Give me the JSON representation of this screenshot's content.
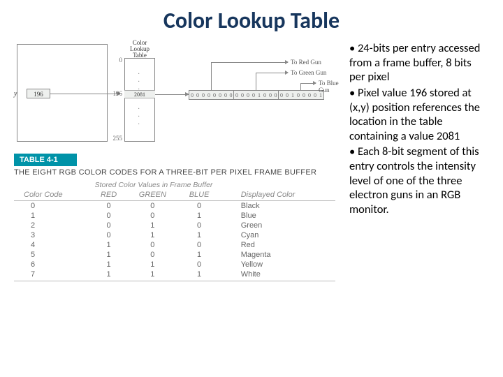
{
  "title": "Color Lookup Table",
  "bullets": {
    "b1": "• 24-bits per entry accessed from a frame buffer, 8 bits per pixel",
    "b2": "• Pixel value 196 stored at (x,y) position references the location in the table containing a value 2081",
    "b3": "• Each 8-bit segment of this entry controls the intensity level of one of the three electron guns  in an RGB monitor."
  },
  "diagram": {
    "y": "y",
    "pixel": "196",
    "clt_label": "Color\nLookup\nTable",
    "idx0": "0",
    "idx196": "196",
    "idx255": "255",
    "entry": "2081",
    "bits": [
      "0",
      "0",
      "0",
      "0",
      "0",
      "0",
      "0",
      "0",
      "0",
      "0",
      "0",
      "0",
      "1",
      "0",
      "0",
      "0",
      "0",
      "0",
      "1",
      "0",
      "0",
      "0",
      "0",
      "1"
    ],
    "red": "To Red Gun",
    "green": "To Green Gun",
    "blue": "To Blue Gun"
  },
  "table": {
    "bar": "TABLE 4-1",
    "caption": "THE EIGHT RGB COLOR CODES FOR A THREE-BIT PER PIXEL FRAME BUFFER",
    "subhead": "Stored Color Values in Frame Buffer",
    "headers": {
      "code": "Color Code",
      "red": "RED",
      "green": "GREEN",
      "blue": "BLUE",
      "disp": "Displayed Color"
    },
    "rows": [
      {
        "c": "0",
        "r": "0",
        "g": "0",
        "b": "0",
        "d": "Black"
      },
      {
        "c": "1",
        "r": "0",
        "g": "0",
        "b": "1",
        "d": "Blue"
      },
      {
        "c": "2",
        "r": "0",
        "g": "1",
        "b": "0",
        "d": "Green"
      },
      {
        "c": "3",
        "r": "0",
        "g": "1",
        "b": "1",
        "d": "Cyan"
      },
      {
        "c": "4",
        "r": "1",
        "g": "0",
        "b": "0",
        "d": "Red"
      },
      {
        "c": "5",
        "r": "1",
        "g": "0",
        "b": "1",
        "d": "Magenta"
      },
      {
        "c": "6",
        "r": "1",
        "g": "1",
        "b": "0",
        "d": "Yellow"
      },
      {
        "c": "7",
        "r": "1",
        "g": "1",
        "b": "1",
        "d": "White"
      }
    ]
  }
}
